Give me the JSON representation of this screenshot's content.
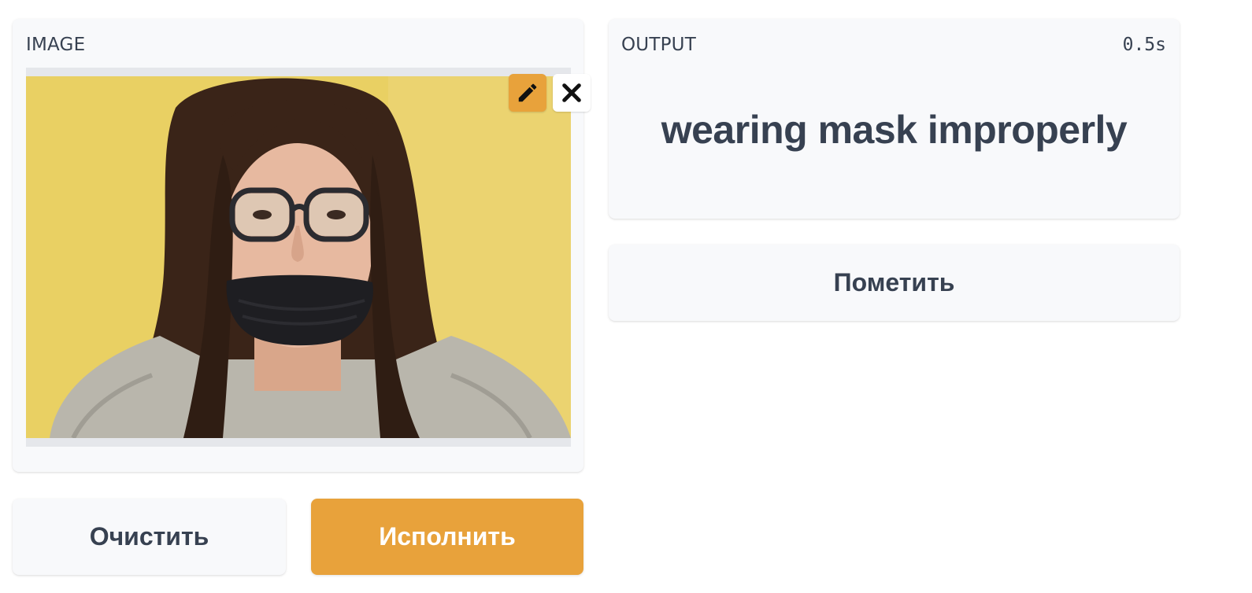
{
  "input": {
    "label": "IMAGE",
    "edit_icon": "pencil-icon",
    "close_icon": "close-icon"
  },
  "output": {
    "label": "OUTPUT",
    "time": "0.5s",
    "result": "wearing mask improperly"
  },
  "buttons": {
    "flag": "Пометить",
    "clear": "Очистить",
    "submit": "Исполнить"
  },
  "colors": {
    "accent": "#e8a23b",
    "panel_bg": "#f8f9fb",
    "text": "#374151"
  }
}
